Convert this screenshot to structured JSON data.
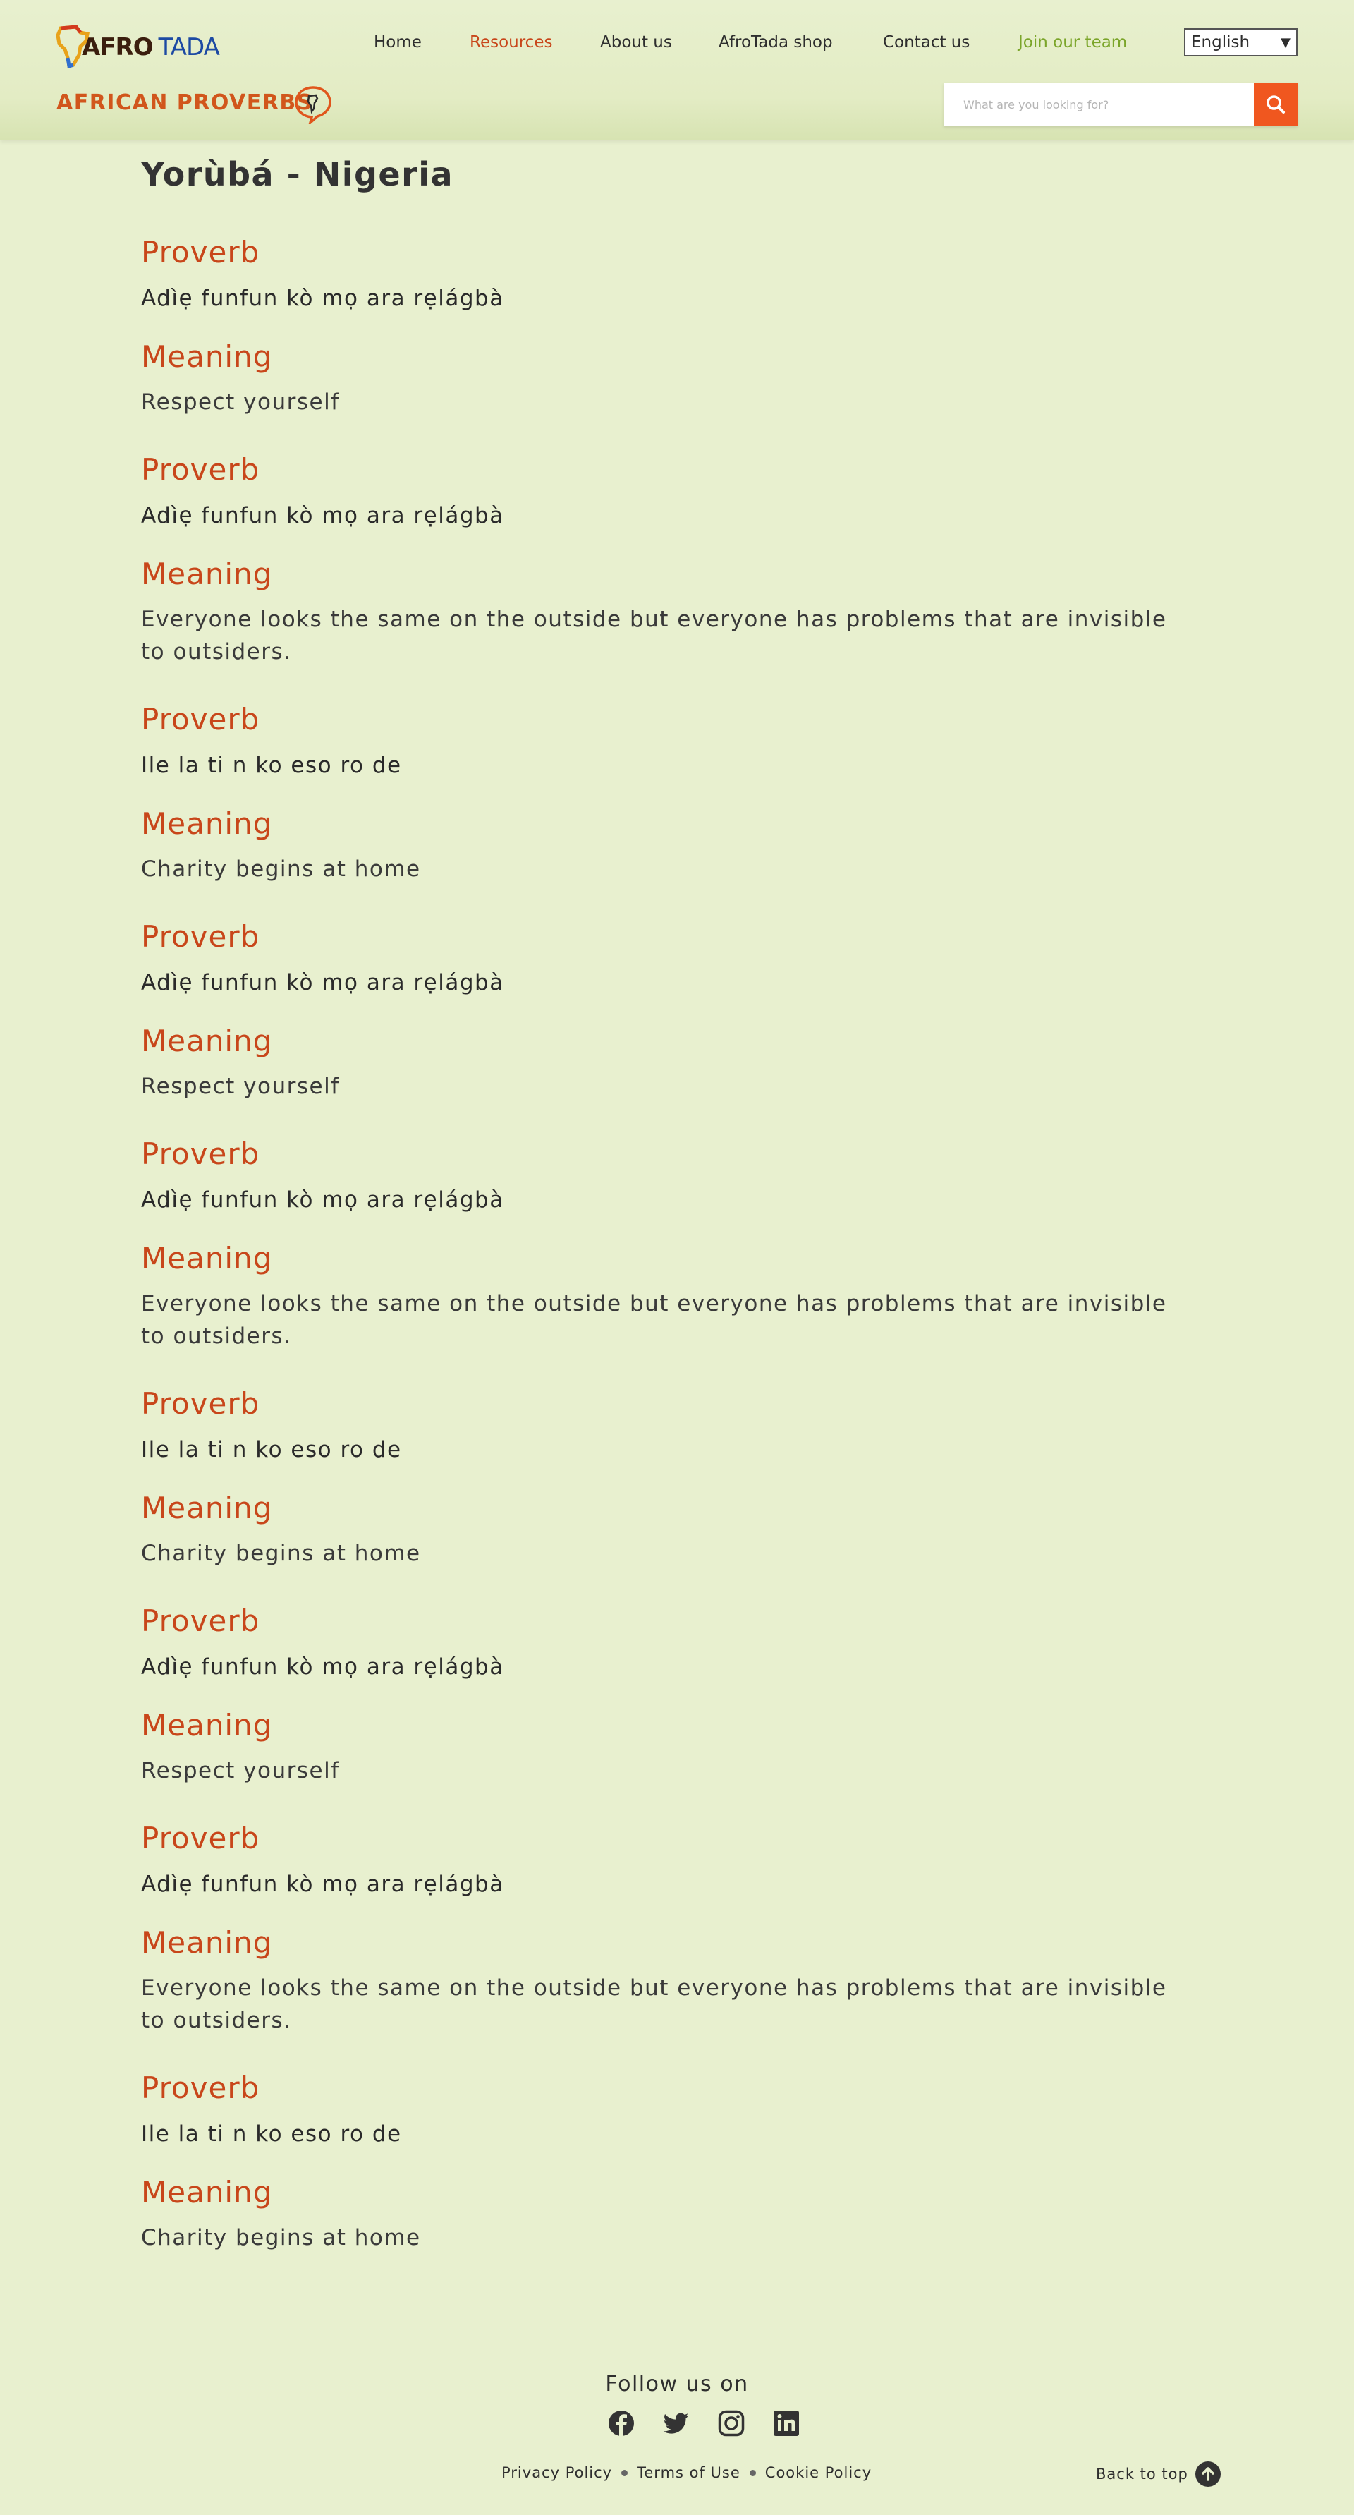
{
  "brand": {
    "afro": "AFRO",
    "tada": "TADA"
  },
  "nav": {
    "home": "Home",
    "resources": "Resources",
    "about": "About us",
    "shop": "AfroTada shop",
    "contact": "Contact us",
    "team": "Join our team"
  },
  "language": {
    "selected": "English"
  },
  "section_title": "AFRICAN PROVERBS",
  "search": {
    "placeholder": "What are you looking for?"
  },
  "page_heading": "Yorùbá - Nigeria",
  "labels": {
    "proverb": "Proverb",
    "meaning": "Meaning"
  },
  "entries": [
    {
      "proverb": "Adìẹ funfun kò mọ ara rẹlágbà",
      "meaning": "Respect yourself"
    },
    {
      "proverb": "Adìẹ funfun kò mọ ara rẹlágbà",
      "meaning": "Everyone looks the same on the outside but everyone has problems that are invisible to outsiders."
    },
    {
      "proverb": "Ile la ti n ko eso ro de",
      "meaning": "Charity begins at home"
    },
    {
      "proverb": "Adìẹ funfun kò mọ ara rẹlágbà",
      "meaning": "Respect yourself"
    },
    {
      "proverb": "Adìẹ funfun kò mọ ara rẹlágbà",
      "meaning": "Everyone looks the same on the outside but everyone has problems that are invisible to outsiders."
    },
    {
      "proverb": "Ile la ti n ko eso ro de",
      "meaning": "Charity begins at home"
    },
    {
      "proverb": "Adìẹ funfun kò mọ ara rẹlágbà",
      "meaning": "Respect yourself"
    },
    {
      "proverb": "Adìẹ funfun kò mọ ara rẹlágbà",
      "meaning": "Everyone looks the same on the outside but everyone has problems that are invisible to outsiders."
    },
    {
      "proverb": "Ile la ti n ko eso ro de",
      "meaning": "Charity begins at home"
    }
  ],
  "footer": {
    "follow": "Follow us on",
    "social_icons": [
      "facebook-icon",
      "twitter-icon",
      "instagram-icon",
      "linkedin-icon"
    ],
    "privacy": "Privacy Policy",
    "terms": "Terms of Use",
    "cookie": "Cookie Policy",
    "back_to_top": "Back to top"
  },
  "colors": {
    "background": "#e8f0cf",
    "accent_orange": "#c8461a",
    "search_button": "#f0571f",
    "team_green": "#7ba52a",
    "logo_blue": "#1d4aa3"
  }
}
